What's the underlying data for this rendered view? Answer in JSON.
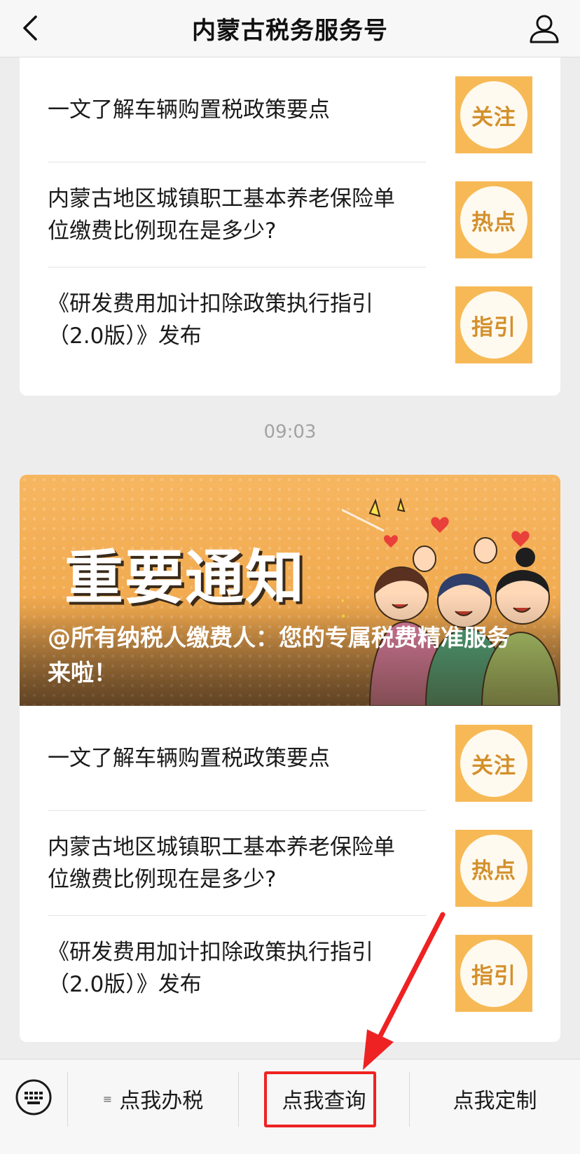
{
  "header": {
    "title": "内蒙古税务服务号"
  },
  "timestamp": "09:03",
  "first_card": {
    "articles": [
      {
        "title": "一文了解车辆购置税政策要点",
        "badge": "关注"
      },
      {
        "title": "内蒙古地区城镇职工基本养老保险单位缴费比例现在是多少?",
        "badge": "热点"
      },
      {
        "title": "《研发费用加计扣除政策执行指引（2.0版）》发布",
        "badge": "指引"
      }
    ]
  },
  "second_card": {
    "banner": {
      "headline": "重要通知",
      "caption": "@所有纳税人缴费人：您的专属税费精准服务来啦！"
    },
    "articles": [
      {
        "title": "一文了解车辆购置税政策要点",
        "badge": "关注"
      },
      {
        "title": "内蒙古地区城镇职工基本养老保险单位缴费比例现在是多少?",
        "badge": "热点"
      },
      {
        "title": "《研发费用加计扣除政策执行指引（2.0版）》发布",
        "badge": "指引"
      }
    ]
  },
  "menu": {
    "items": [
      {
        "label": "点我办税",
        "has_submenu_icon": true
      },
      {
        "label": "点我查询"
      },
      {
        "label": "点我定制"
      }
    ],
    "submenu_glyph": "≡"
  },
  "colors": {
    "accent": "#f7b955",
    "badge_text": "#d3902c",
    "highlight": "#ee2222"
  }
}
